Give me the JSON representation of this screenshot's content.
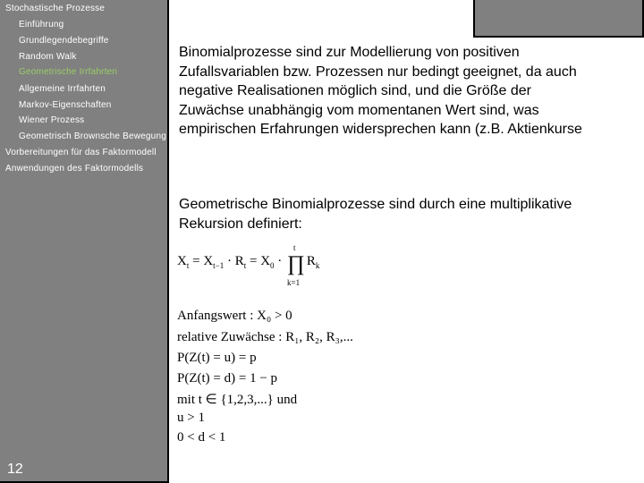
{
  "sidebar": {
    "items": [
      {
        "label": "Stochastische Prozesse",
        "level": 0,
        "active": false
      },
      {
        "label": "Einführung",
        "level": 1,
        "active": false
      },
      {
        "label": "Grundlegendebegriffe",
        "level": 1,
        "active": false
      },
      {
        "label": "Random Walk",
        "level": 1,
        "active": false
      },
      {
        "label": "Geometrische Irrfahrten",
        "level": 1,
        "active": true
      },
      {
        "label": "Allgemeine Irrfahrten",
        "level": 1,
        "active": false
      },
      {
        "label": "Markov-Eigenschaften",
        "level": 1,
        "active": false
      },
      {
        "label": "Wiener Prozess",
        "level": 1,
        "active": false
      },
      {
        "label": "Geometrisch Brownsche Bewegung",
        "level": 1,
        "active": false
      },
      {
        "label": "Vorbereitungen für das Faktormodell",
        "level": 0,
        "active": false
      },
      {
        "label": "Anwendungen des Faktormodells",
        "level": 0,
        "active": false
      }
    ],
    "page_number": "12",
    "active_color": "#99cc66"
  },
  "content": {
    "paragraph1": "Binomialprozesse sind zur Modellierung von positiven\nZufallsvariablen bzw. Prozessen nur bedingt geeignet, da auch\nnegative Realisationen möglich sind, und die Größe der\nZuwächse unabhängig vom momentanen Wert sind, was\nempirischen Erfahrungen widersprechen kann (z.B. Aktienkurse",
    "paragraph2": "Geometrische Binomialprozesse sind durch eine multiplikative\nRekursion definiert:",
    "formulas": {
      "recursion": {
        "lhs": "X",
        "lhs_sub": "t",
        "eq1": " = X",
        "term1_sub": "t−1",
        "mid": " · R",
        "mid_sub": "t",
        "eq2": " = X",
        "term2_sub": "0",
        "dot": " · ",
        "prod_symbol": "∏",
        "prod_upper": "t",
        "prod_lower": "k=1",
        "tail": "R",
        "tail_sub": "k"
      },
      "lines": [
        "Anfangswert : X₀ > 0",
        "relative Zuwächse : R₁, R₂, R₃,...",
        "P(Z(t) = u) = p",
        "P(Z(t) = d) = 1 − p",
        "mit t ∈ {1,2,3,...} und",
        "u > 1",
        "0 < d < 1"
      ]
    }
  }
}
